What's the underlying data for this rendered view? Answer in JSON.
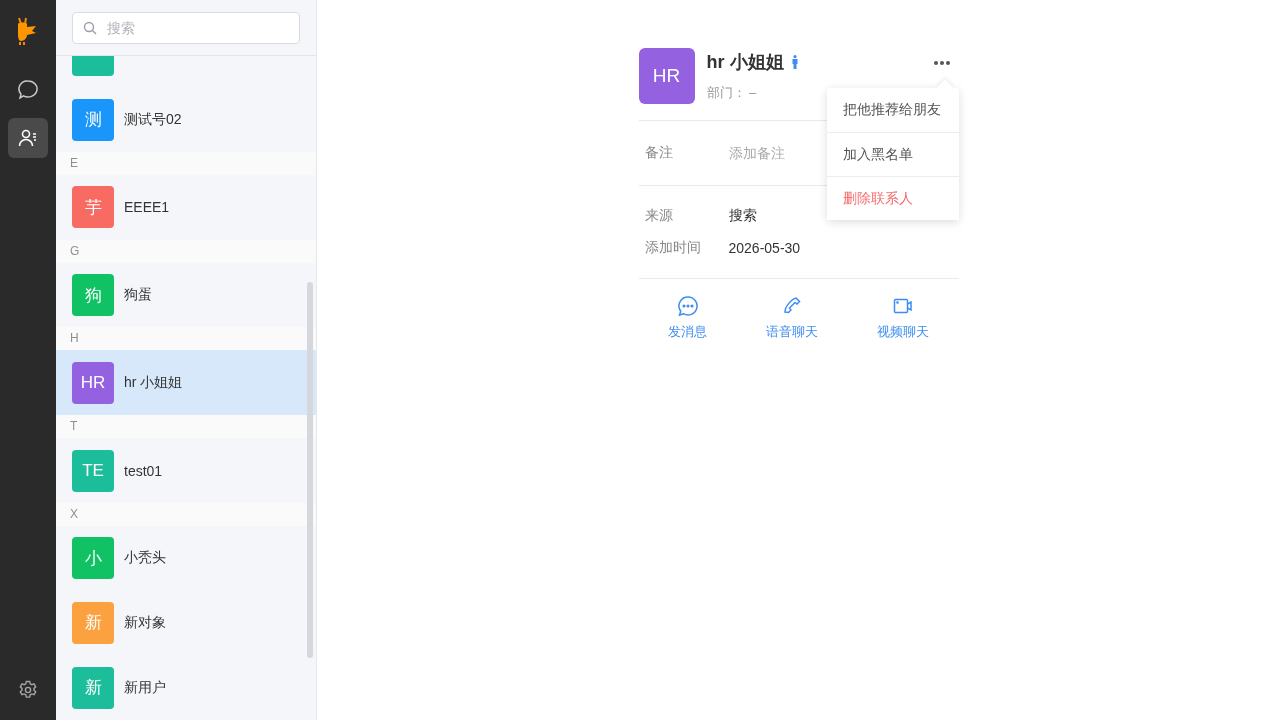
{
  "sidebar": {
    "nav": [
      {
        "kind": "chat",
        "selected": false
      },
      {
        "kind": "contacts",
        "selected": true
      }
    ]
  },
  "contacts": {
    "search": {
      "placeholder": "搜索"
    },
    "groups": [
      {
        "items": [
          {
            "kind": "partial",
            "color": "#1bbd9a"
          },
          {
            "kind": "contact",
            "avatar": "测",
            "name": "测试号02",
            "color": "#1a95fa",
            "selected": false
          }
        ]
      },
      {
        "letter": "E",
        "items": [
          {
            "kind": "contact",
            "avatar": "芋",
            "name": "EEEE1",
            "color": "#f76b62",
            "selected": false
          }
        ]
      },
      {
        "letter": "G",
        "items": [
          {
            "kind": "contact",
            "avatar": "狗",
            "name": "狗蛋",
            "color": "#10c264",
            "selected": false
          }
        ]
      },
      {
        "letter": "H",
        "items": [
          {
            "kind": "contact",
            "avatar": "HR",
            "name": "hr 小姐姐",
            "color": "#9461e0",
            "selected": true
          }
        ]
      },
      {
        "letter": "T",
        "items": [
          {
            "kind": "contact",
            "avatar": "TE",
            "name": "test01",
            "color": "#1bbd9a",
            "selected": false
          }
        ]
      },
      {
        "letter": "X",
        "items": [
          {
            "kind": "contact",
            "avatar": "小",
            "name": "小秃头",
            "color": "#10c264",
            "selected": false
          },
          {
            "kind": "contact",
            "avatar": "新",
            "name": "新对象",
            "color": "#fca13f",
            "selected": false
          },
          {
            "kind": "contact",
            "avatar": "新",
            "name": "新用户",
            "color": "#1bbd9a",
            "selected": false
          }
        ]
      }
    ]
  },
  "detail": {
    "avatar": "HR",
    "name": "hr 小姐姐",
    "department": "部门： –",
    "menu": [
      {
        "label": "把他推荐给朋友",
        "kind": "normal"
      },
      {
        "label": "加入黑名单",
        "kind": "normal"
      },
      {
        "label": "删除联系人",
        "kind": "danger"
      }
    ],
    "remark": {
      "label": "备注",
      "placeholder": "添加备注"
    },
    "info": [
      {
        "label": "来源",
        "value": "搜索"
      },
      {
        "label": "添加时间",
        "value": "2026-05-30"
      }
    ],
    "actions": [
      {
        "kind": "message",
        "label": "发消息"
      },
      {
        "kind": "voice",
        "label": "语音聊天"
      },
      {
        "kind": "video",
        "label": "视频聊天"
      }
    ]
  }
}
